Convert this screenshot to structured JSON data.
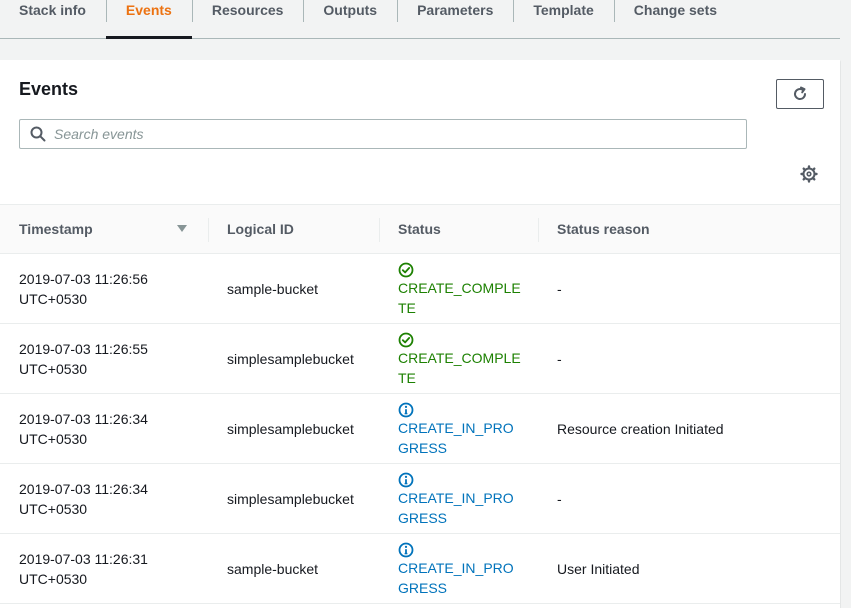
{
  "tabs": [
    {
      "label": "Stack info",
      "active": false
    },
    {
      "label": "Events",
      "active": true
    },
    {
      "label": "Resources",
      "active": false
    },
    {
      "label": "Outputs",
      "active": false
    },
    {
      "label": "Parameters",
      "active": false
    },
    {
      "label": "Template",
      "active": false
    },
    {
      "label": "Change sets",
      "active": false
    }
  ],
  "panel": {
    "title": "Events",
    "search_placeholder": "Search events",
    "search_value": ""
  },
  "table": {
    "columns": [
      "Timestamp",
      "Logical ID",
      "Status",
      "Status reason"
    ],
    "rows": [
      {
        "timestamp": "2019-07-03 11:26:56 UTC+0530",
        "logical_id": "sample-bucket",
        "status": "CREATE_COMPLETE",
        "status_type": "success",
        "reason": "-"
      },
      {
        "timestamp": "2019-07-03 11:26:55 UTC+0530",
        "logical_id": "simplesamplebucket",
        "status": "CREATE_COMPLETE",
        "status_type": "success",
        "reason": "-"
      },
      {
        "timestamp": "2019-07-03 11:26:34 UTC+0530",
        "logical_id": "simplesamplebucket",
        "status": "CREATE_IN_PROGRESS",
        "status_type": "info",
        "reason": "Resource creation Initiated"
      },
      {
        "timestamp": "2019-07-03 11:26:34 UTC+0530",
        "logical_id": "simplesamplebucket",
        "status": "CREATE_IN_PROGRESS",
        "status_type": "info",
        "reason": "-"
      },
      {
        "timestamp": "2019-07-03 11:26:31 UTC+0530",
        "logical_id": "sample-bucket",
        "status": "CREATE_IN_PROGRESS",
        "status_type": "info",
        "reason": "User Initiated"
      }
    ]
  },
  "icons": {
    "refresh": "refresh-icon",
    "search": "search-icon",
    "settings": "gear-icon",
    "sort": "sort-descending-icon",
    "success": "check-circle-icon",
    "info": "info-circle-icon"
  },
  "colors": {
    "active_tab": "#ec7211",
    "success": "#1d8102",
    "info": "#0073bb"
  }
}
